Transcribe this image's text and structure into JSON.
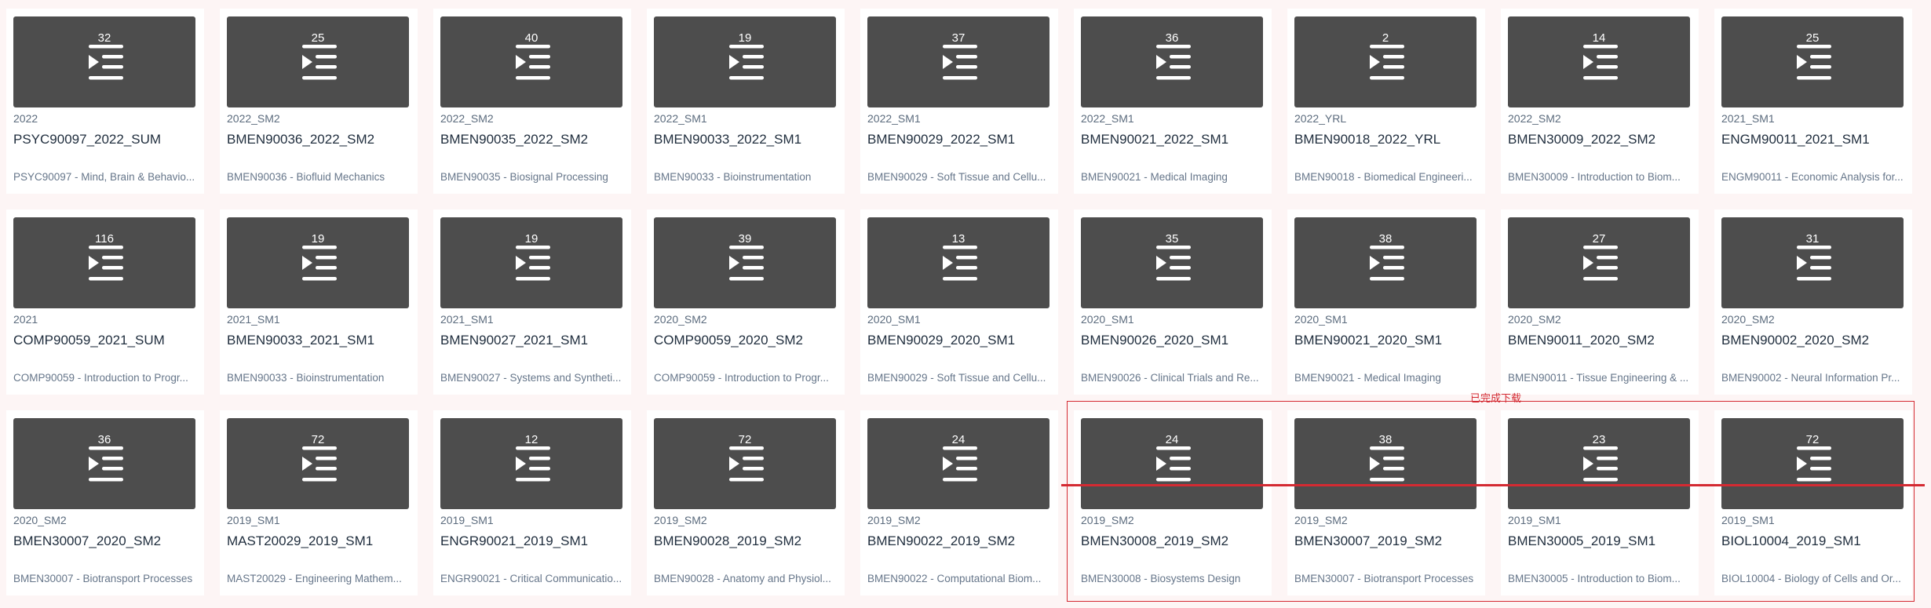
{
  "annotation": {
    "label": "已完成下载",
    "color": "#d42a32"
  },
  "colors": {
    "background": "#fdf5f5",
    "thumbnail": "#4d4d4d",
    "title": "#1f2d3d",
    "subtitle": "#5b6b7d"
  },
  "icon": "playlist-icon",
  "cards": [
    {
      "count": "32",
      "term": "2022",
      "title": "PSYC90097_2022_SUM",
      "desc": "PSYC90097 - Mind, Brain & Behavio..."
    },
    {
      "count": "25",
      "term": "2022_SM2",
      "title": "BMEN90036_2022_SM2",
      "desc": "BMEN90036 - Biofluid Mechanics"
    },
    {
      "count": "40",
      "term": "2022_SM2",
      "title": "BMEN90035_2022_SM2",
      "desc": "BMEN90035 - Biosignal Processing"
    },
    {
      "count": "19",
      "term": "2022_SM1",
      "title": "BMEN90033_2022_SM1",
      "desc": "BMEN90033 - Bioinstrumentation"
    },
    {
      "count": "37",
      "term": "2022_SM1",
      "title": "BMEN90029_2022_SM1",
      "desc": "BMEN90029 - Soft Tissue and Cellu..."
    },
    {
      "count": "36",
      "term": "2022_SM1",
      "title": "BMEN90021_2022_SM1",
      "desc": "BMEN90021 - Medical Imaging"
    },
    {
      "count": "2",
      "term": "2022_YRL",
      "title": "BMEN90018_2022_YRL",
      "desc": "BMEN90018 - Biomedical Engineeri..."
    },
    {
      "count": "14",
      "term": "2022_SM2",
      "title": "BMEN30009_2022_SM2",
      "desc": "BMEN30009 - Introduction to Biom..."
    },
    {
      "count": "25",
      "term": "2021_SM1",
      "title": "ENGM90011_2021_SM1",
      "desc": "ENGM90011 - Economic Analysis for..."
    },
    {
      "count": "116",
      "term": "2021",
      "title": "COMP90059_2021_SUM",
      "desc": "COMP90059 - Introduction to Progr..."
    },
    {
      "count": "19",
      "term": "2021_SM1",
      "title": "BMEN90033_2021_SM1",
      "desc": "BMEN90033 - Bioinstrumentation"
    },
    {
      "count": "19",
      "term": "2021_SM1",
      "title": "BMEN90027_2021_SM1",
      "desc": "BMEN90027 - Systems and Syntheti..."
    },
    {
      "count": "39",
      "term": "2020_SM2",
      "title": "COMP90059_2020_SM2",
      "desc": "COMP90059 - Introduction to Progr..."
    },
    {
      "count": "13",
      "term": "2020_SM1",
      "title": "BMEN90029_2020_SM1",
      "desc": "BMEN90029 - Soft Tissue and Cellu..."
    },
    {
      "count": "35",
      "term": "2020_SM1",
      "title": "BMEN90026_2020_SM1",
      "desc": "BMEN90026 - Clinical Trials and Re..."
    },
    {
      "count": "38",
      "term": "2020_SM1",
      "title": "BMEN90021_2020_SM1",
      "desc": "BMEN90021 - Medical Imaging"
    },
    {
      "count": "27",
      "term": "2020_SM2",
      "title": "BMEN90011_2020_SM2",
      "desc": "BMEN90011 - Tissue Engineering & ..."
    },
    {
      "count": "31",
      "term": "2020_SM2",
      "title": "BMEN90002_2020_SM2",
      "desc": "BMEN90002 - Neural Information Pr..."
    },
    {
      "count": "36",
      "term": "2020_SM2",
      "title": "BMEN30007_2020_SM2",
      "desc": "BMEN30007 - Biotransport Processes"
    },
    {
      "count": "72",
      "term": "2019_SM1",
      "title": "MAST20029_2019_SM1",
      "desc": "MAST20029 - Engineering Mathem..."
    },
    {
      "count": "12",
      "term": "2019_SM1",
      "title": "ENGR90021_2019_SM1",
      "desc": "ENGR90021 - Critical Communicatio..."
    },
    {
      "count": "72",
      "term": "2019_SM2",
      "title": "BMEN90028_2019_SM2",
      "desc": "BMEN90028 - Anatomy and Physiol..."
    },
    {
      "count": "24",
      "term": "2019_SM2",
      "title": "BMEN90022_2019_SM2",
      "desc": "BMEN90022 - Computational Biom..."
    },
    {
      "count": "24",
      "term": "2019_SM2",
      "title": "BMEN30008_2019_SM2",
      "desc": "BMEN30008 - Biosystems Design"
    },
    {
      "count": "38",
      "term": "2019_SM2",
      "title": "BMEN30007_2019_SM2",
      "desc": "BMEN30007 - Biotransport Processes"
    },
    {
      "count": "23",
      "term": "2019_SM1",
      "title": "BMEN30005_2019_SM1",
      "desc": "BMEN30005 - Introduction to Biom..."
    },
    {
      "count": "72",
      "term": "2019_SM1",
      "title": "BIOL10004_2019_SM1",
      "desc": "BIOL10004 - Biology of Cells and Or..."
    }
  ]
}
